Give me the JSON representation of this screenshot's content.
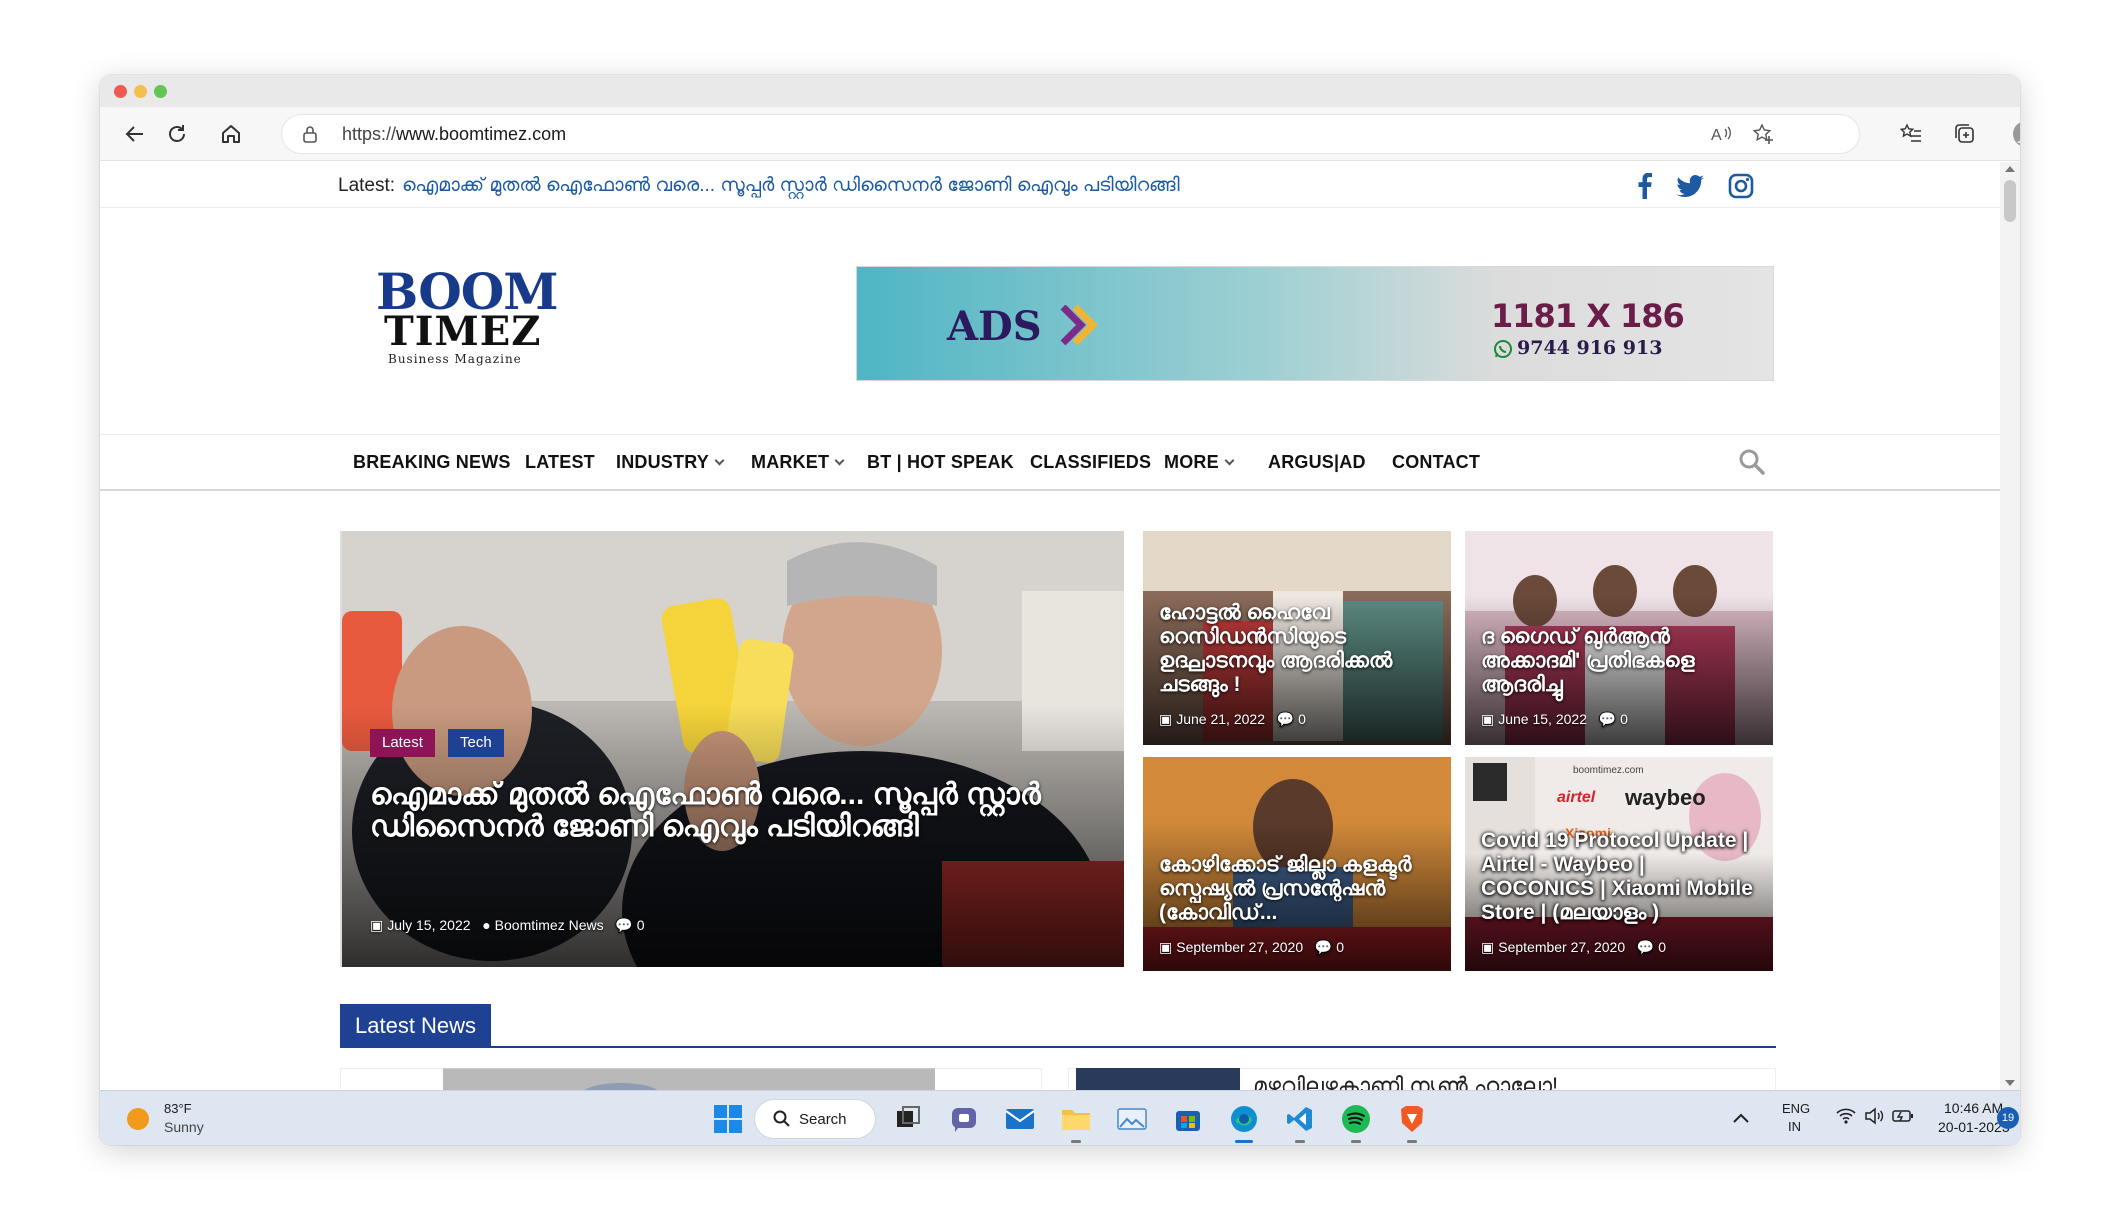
{
  "browser": {
    "url_scheme": "https://",
    "url_host": "www.boomtimez.com"
  },
  "ticker": {
    "label": "Latest:",
    "headline": "ഐമാക്ക് മുതൽ ഐഫോൺ വരെ... സൂപ്പർ സ്റ്റാർ ഡിസൈനർ ജോണി ഐവും പടിയിറങ്ങി"
  },
  "logo": {
    "top": "BOOM",
    "bottom": "TIMEZ",
    "tagline": "Business Magazine"
  },
  "ad": {
    "brand": "ADS",
    "size": "1181 X 186",
    "phone": "9744 916 913"
  },
  "nav": {
    "items": [
      {
        "label": "BREAKING NEWS",
        "dropdown": false
      },
      {
        "label": "LATEST",
        "dropdown": false
      },
      {
        "label": "INDUSTRY",
        "dropdown": true
      },
      {
        "label": "MARKET",
        "dropdown": true
      },
      {
        "label": "BT | HOT SPEAK",
        "dropdown": false
      },
      {
        "label": "CLASSIFIEDS",
        "dropdown": false
      },
      {
        "label": "MORE",
        "dropdown": true
      },
      {
        "label": "ARGUS|AD",
        "dropdown": false
      },
      {
        "label": "CONTACT",
        "dropdown": false
      }
    ]
  },
  "hero": {
    "tags": [
      "Latest",
      "Tech"
    ],
    "title": "ഐമാക്ക് മുതൽ ഐഫോൺ വരെ... സൂപ്പർ സ്റ്റാർ ഡിസൈനർ ജോണി ഐവും പടിയിറങ്ങി",
    "date": "July 15, 2022",
    "author": "Boomtimez News",
    "comments": "0"
  },
  "cards": [
    {
      "title": "ഹോട്ടൽ ഹൈവേ റെസിഡൻസിയുടെ ഉദ്ഘാടനവും ആദരിക്കൽ ചടങ്ങും !",
      "date": "June 21, 2022",
      "comments": "0"
    },
    {
      "title": "ദ ഗൈഡ് ഖുർആൻ അക്കാദമി' പ്രതിഭകളെ ആദരിച്ചു",
      "date": "June 15, 2022",
      "comments": "0"
    },
    {
      "title": "കോഴിക്കോട് ജില്ലാ കളക്ടർ സ്പെഷ്യൽ പ്രസന്റേഷൻ (കോവിഡ്...",
      "date": "September 27, 2020",
      "comments": "0"
    },
    {
      "title": "Covid 19 Protocol Update | Airtel - Waybeo | COCONICS | Xiaomi Mobile Store | (മലയാളം )",
      "date": "September 27, 2020",
      "comments": "0"
    }
  ],
  "card_overlays": {
    "airtel": "airtel",
    "waybeo": "waybeo",
    "mi": "Xiaomi",
    "site": "boomtimez.com"
  },
  "latest_news": {
    "heading": "Latest News",
    "teaser": "മഴവില്ലഴകാണി ന്യൂൺ ഹാലോ!"
  },
  "taskbar": {
    "weather_temp": "83°F",
    "weather_desc": "Sunny",
    "search_label": "Search",
    "lang_top": "ENG",
    "lang_bottom": "IN",
    "time": "10:46 AM",
    "date": "20-01-2023",
    "notifications": "19"
  },
  "colors": {
    "brand_blue": "#1f4193",
    "link_blue": "#1b5aa6",
    "tag_latest": "#8d1457",
    "tag_tech": "#1f4193"
  }
}
